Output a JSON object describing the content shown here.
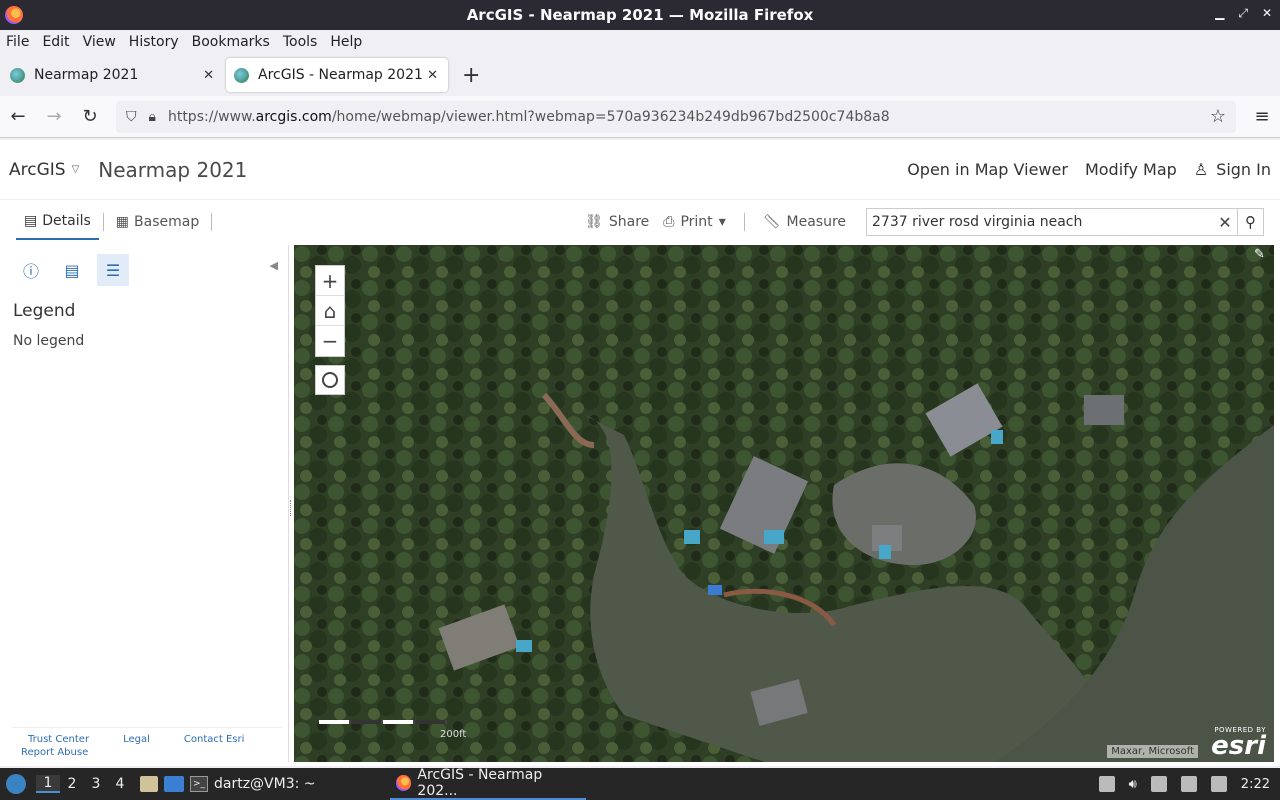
{
  "window": {
    "title": "ArcGIS - Nearmap 2021 — Mozilla Firefox"
  },
  "menu": [
    "File",
    "Edit",
    "View",
    "History",
    "Bookmarks",
    "Tools",
    "Help"
  ],
  "tabs": [
    {
      "label": "Nearmap 2021"
    },
    {
      "label": "ArcGIS - Nearmap 2021"
    }
  ],
  "nav": {
    "url_prefix": "https://www.",
    "url_domain": "arcgis.com",
    "url_rest": "/home/webmap/viewer.html?webmap=570a936234b249db967bd2500c74b8a8"
  },
  "app": {
    "brand": "ArcGIS",
    "map_title": "Nearmap 2021",
    "open_in_map_viewer": "Open in Map Viewer",
    "modify_map": "Modify Map",
    "sign_in": "Sign In"
  },
  "toolbar": {
    "details": "Details",
    "basemap": "Basemap",
    "share": "Share",
    "print": "Print",
    "measure": "Measure",
    "search_value": "2737 river rosd virginia neach"
  },
  "sidebar": {
    "legend_heading": "Legend",
    "legend_empty": "No legend",
    "footer": {
      "trust_center": "Trust Center",
      "legal": "Legal",
      "contact": "Contact Esri",
      "report_abuse": "Report Abuse"
    }
  },
  "map": {
    "zoom_in": "+",
    "zoom_out": "−",
    "scale_label": "200ft",
    "attribution": "Maxar, Microsoft",
    "powered_by": "POWERED BY",
    "esri": "esri"
  },
  "taskbar": {
    "workspaces": [
      "1",
      "2",
      "3",
      "4"
    ],
    "terminal": "dartz@VM3: ~",
    "firefox": "ArcGIS - Nearmap 202...",
    "clock": "2:22"
  }
}
